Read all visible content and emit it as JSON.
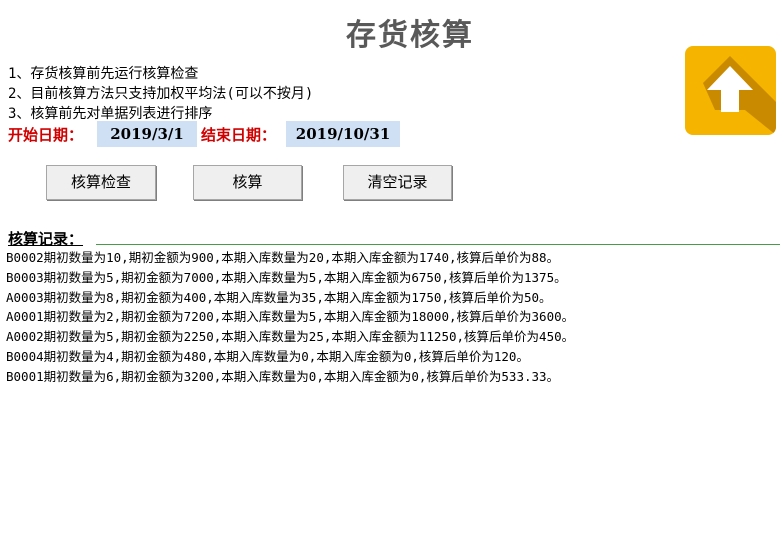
{
  "title": "存货核算",
  "notes": [
    "1、存货核算前先运行核算检查",
    "2、目前核算方法只支持加权平均法(可以不按月)",
    "3、核算前先对单据列表进行排序"
  ],
  "dates": {
    "start_label": "开始日期：",
    "start_value": "2019/3/1",
    "end_label": "结束日期：",
    "end_value": "2019/10/31"
  },
  "buttons": {
    "check": "核算检查",
    "run": "核算",
    "clear": "清空记录"
  },
  "log": {
    "title": "核算记录：",
    "entries": [
      "B0002期初数量为10,期初金额为900,本期入库数量为20,本期入库金额为1740,核算后单价为88。",
      "B0003期初数量为5,期初金额为7000,本期入库数量为5,本期入库金额为6750,核算后单价为1375。",
      "A0003期初数量为8,期初金额为400,本期入库数量为35,本期入库金额为1750,核算后单价为50。",
      "A0001期初数量为2,期初金额为7200,本期入库数量为5,本期入库金额为18000,核算后单价为3600。",
      "A0002期初数量为5,期初金额为2250,本期入库数量为25,本期入库金额为11250,核算后单价为450。",
      "B0004期初数量为4,期初金额为480,本期入库数量为0,本期入库金额为0,核算后单价为120。",
      "B0001期初数量为6,期初金额为3200,本期入库数量为0,本期入库金额为0,核算后单价为533.33。"
    ]
  },
  "upload_icon": "arrow-up-icon",
  "colors": {
    "accent_red": "#d00000",
    "date_bg": "#cfe0f5",
    "tile_bg": "#f4b400"
  }
}
